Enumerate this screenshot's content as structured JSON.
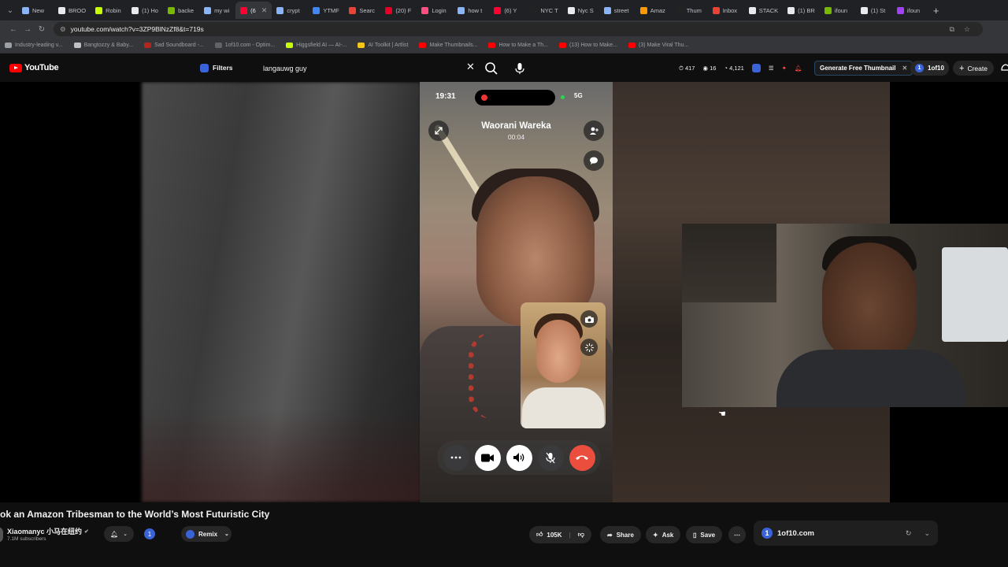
{
  "browser": {
    "tabs": [
      {
        "label": "New",
        "color": "#8ab4f8"
      },
      {
        "label": "BROO",
        "color": "#e8eaed"
      },
      {
        "label": "Robin",
        "color": "#c6ff00"
      },
      {
        "label": "(1) Ho",
        "color": "#e8eaed"
      },
      {
        "label": "backe",
        "color": "#76b900"
      },
      {
        "label": "my wi",
        "color": "#8ab4f8"
      },
      {
        "label": "(6",
        "color": "#ff0033",
        "active": true
      },
      {
        "label": "crypt",
        "color": "#8ab4f8"
      },
      {
        "label": "YTMF",
        "color": "#4285f4"
      },
      {
        "label": "Searc",
        "color": "#ea4335"
      },
      {
        "label": "(20) F",
        "color": "#e60023"
      },
      {
        "label": "Login",
        "color": "#ff4f81"
      },
      {
        "label": "how t",
        "color": "#8ab4f8"
      },
      {
        "label": "(6) Y",
        "color": "#ff0033"
      },
      {
        "label": "NYC T",
        "color": "#222"
      },
      {
        "label": "Nyc S",
        "color": "#e8eaed"
      },
      {
        "label": "street",
        "color": "#8ab4f8"
      },
      {
        "label": "Amaz",
        "color": "#ff9900"
      },
      {
        "label": "Thum",
        "color": "#222"
      },
      {
        "label": "Inbox",
        "color": "#ea4335"
      },
      {
        "label": "STACK",
        "color": "#e8eaed"
      },
      {
        "label": "(1) BR",
        "color": "#e8eaed"
      },
      {
        "label": "ifoun",
        "color": "#76b900"
      },
      {
        "label": "(1) St",
        "color": "#e8eaed"
      },
      {
        "label": "ifoun",
        "color": "#a142f4"
      }
    ],
    "new_tab": "+",
    "url": "youtube.com/watch?v=3ZP9BlNzZf8&t=719s",
    "bookmarks": [
      {
        "label": "Industry-leading v...",
        "color": "#9aa0a6"
      },
      {
        "label": "Bangtozzy & Baby...",
        "color": "#bdc1c6"
      },
      {
        "label": "Sad Soundboard -...",
        "color": "#b3261e"
      },
      {
        "label": "1of10.com - Optim...",
        "color": "#5f6368"
      },
      {
        "label": "Higgsfield AI — AI-...",
        "color": "#c6ff00"
      },
      {
        "label": "AI Toolkit | Artlist",
        "color": "#f5c518"
      },
      {
        "label": "Make Thumbnails...",
        "color": "#ff0000"
      },
      {
        "label": "How to Make a Th...",
        "color": "#ff0000"
      },
      {
        "label": "(13) How to Make...",
        "color": "#ff0000"
      },
      {
        "label": "(3) Make Viral Thu...",
        "color": "#ff0000"
      }
    ]
  },
  "youtube": {
    "logo_text": "YouTube",
    "filters_label": "Filters",
    "search_query": "langauwg guy",
    "stats": {
      "a": "417",
      "b": "16",
      "c": "4,121"
    },
    "generate_thumbnail": "Generate Free Thumbnail",
    "oneof10_label": "1of10",
    "create_label": "Create"
  },
  "call": {
    "status_time": "19:31",
    "signal": "5G",
    "caller_name": "Waorani Wareka",
    "duration": "00:04"
  },
  "video": {
    "title": "ok an Amazon Tribesman to the World’s Most Futuristic City",
    "channel": "Xiaomanyc 小马在纽约",
    "subscribers": "7.1M subscribers",
    "remix_label": "Remix",
    "likes": "105K",
    "share_label": "Share",
    "ask_label": "Ask",
    "save_label": "Save",
    "one_badge": "1"
  },
  "sidepanel": {
    "label": "1of10.com"
  }
}
